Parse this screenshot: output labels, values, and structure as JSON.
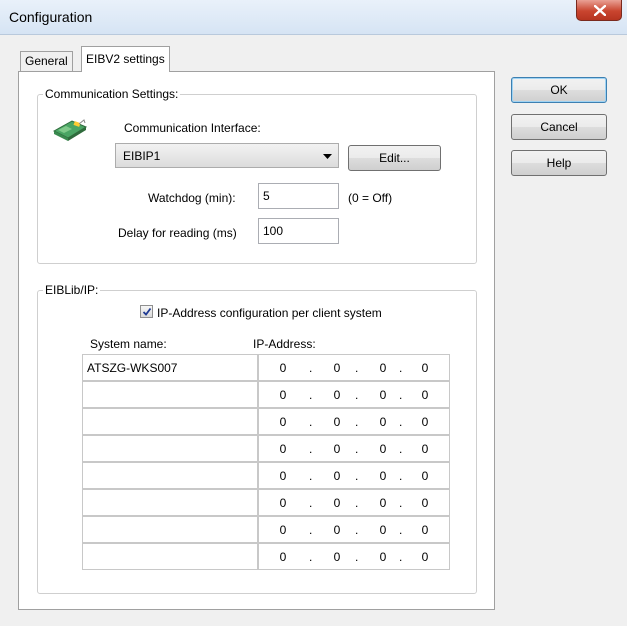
{
  "window": {
    "title": "Configuration",
    "close_symbol": "✕"
  },
  "tabs": [
    {
      "label": "General",
      "selected": false
    },
    {
      "label": "EIBV2 settings",
      "selected": true
    }
  ],
  "buttons": {
    "ok": "OK",
    "cancel": "Cancel",
    "help": "Help"
  },
  "communication": {
    "legend": "Communication Settings:",
    "icon": "network-card-icon",
    "interface_label": "Communication Interface:",
    "interface_value": "EIBIP1",
    "edit_button": "Edit...",
    "watchdog_label": "Watchdog (min):",
    "watchdog_value": "5",
    "watchdog_hint": "(0 = Off)",
    "delay_label": "Delay for reading (ms)",
    "delay_value": "100"
  },
  "eiblib": {
    "legend": "EIBLib/IP:",
    "checkbox_label": "IP-Address configuration per client system",
    "checkbox_checked": true,
    "col_system": "System name:",
    "col_ip": "IP-Address:",
    "rows": [
      {
        "system": "ATSZG-WKS007",
        "ip": [
          "0",
          "0",
          "0",
          "0"
        ]
      },
      {
        "system": "",
        "ip": [
          "0",
          "0",
          "0",
          "0"
        ]
      },
      {
        "system": "",
        "ip": [
          "0",
          "0",
          "0",
          "0"
        ]
      },
      {
        "system": "",
        "ip": [
          "0",
          "0",
          "0",
          "0"
        ]
      },
      {
        "system": "",
        "ip": [
          "0",
          "0",
          "0",
          "0"
        ]
      },
      {
        "system": "",
        "ip": [
          "0",
          "0",
          "0",
          "0"
        ]
      },
      {
        "system": "",
        "ip": [
          "0",
          "0",
          "0",
          "0"
        ]
      },
      {
        "system": "",
        "ip": [
          "0",
          "0",
          "0",
          "0"
        ]
      }
    ]
  },
  "colors": {
    "titlebar": "#dbe8f6",
    "close_button": "#c9452f",
    "panel": "#ffffff",
    "default_button_border": "#3c7fb1"
  }
}
